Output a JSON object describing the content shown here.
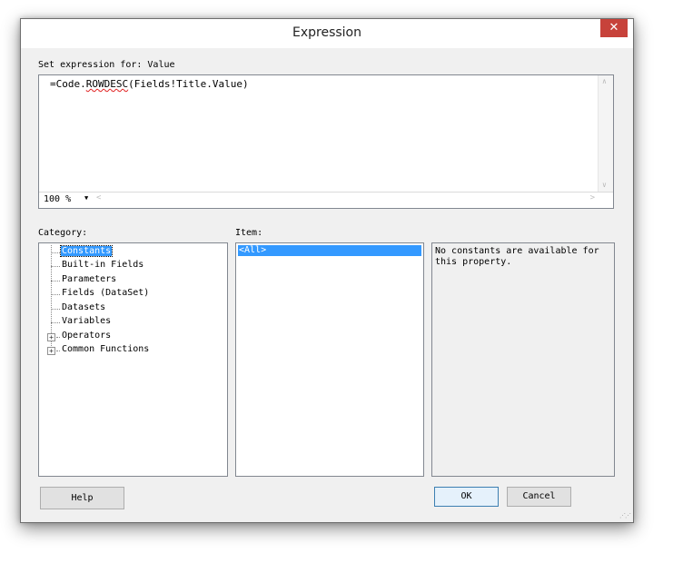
{
  "window": {
    "title": "Expression",
    "close_glyph": "✕"
  },
  "editor": {
    "label": "Set expression for: Value",
    "expression_prefix": "=Code.",
    "expression_flagged": "ROWDESC",
    "expression_suffix": "(Fields!Title.Value)",
    "zoom": "100 %"
  },
  "category": {
    "label": "Category:",
    "items": [
      {
        "label": "Constants",
        "selected": true,
        "expandable": false
      },
      {
        "label": "Built-in Fields",
        "selected": false,
        "expandable": false
      },
      {
        "label": "Parameters",
        "selected": false,
        "expandable": false
      },
      {
        "label": "Fields (DataSet)",
        "selected": false,
        "expandable": false
      },
      {
        "label": "Datasets",
        "selected": false,
        "expandable": false
      },
      {
        "label": "Variables",
        "selected": false,
        "expandable": false
      },
      {
        "label": "Operators",
        "selected": false,
        "expandable": true
      },
      {
        "label": "Common Functions",
        "selected": false,
        "expandable": true
      }
    ]
  },
  "item": {
    "label": "Item:",
    "items": [
      {
        "label": "<All>",
        "selected": true
      }
    ]
  },
  "description": {
    "text": "No constants are available for this property."
  },
  "buttons": {
    "help": "Help",
    "ok": "OK",
    "cancel": "Cancel"
  },
  "colors": {
    "selection": "#3399ff",
    "close_button": "#c7423a",
    "dialog_bg": "#f0f0f0"
  }
}
